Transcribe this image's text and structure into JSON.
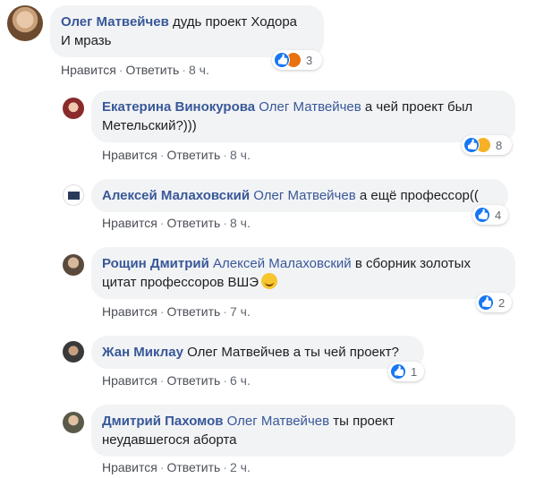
{
  "comments": [
    {
      "author": "Олег Матвейчев",
      "mention": "",
      "text_line1": "дудь проект Ходора",
      "text_line2": "И мразь",
      "like": "Нравится",
      "reply": "Ответить",
      "time": "8 ч.",
      "reaction_count": "3"
    },
    {
      "author": "Екатерина Винокурова",
      "mention": "Олег Матвейчев",
      "text_line1": "а чей проект был",
      "text_line2": "Метельский?)))",
      "like": "Нравится",
      "reply": "Ответить",
      "time": "8 ч.",
      "reaction_count": "8"
    },
    {
      "author": "Алексей Малаховский",
      "mention": "Олег Матвейчев",
      "text_line1": "а ещё профессор((",
      "like": "Нравится",
      "reply": "Ответить",
      "time": "8 ч.",
      "reaction_count": "4"
    },
    {
      "author": "Рощин Дмитрий",
      "mention": "Алексей Малаховский",
      "text_line1": "в сборник золотых",
      "text_line2": "цитат профессоров ВШЭ",
      "like": "Нравится",
      "reply": "Ответить",
      "time": "7 ч.",
      "reaction_count": "2"
    },
    {
      "author": "Жан Миклау",
      "mention": "Олег Матвейчев",
      "text_line1": "а ты чей проект?",
      "like": "Нравится",
      "reply": "Ответить",
      "time": "6 ч.",
      "reaction_count": "1"
    },
    {
      "author": "Дмитрий Пахомов",
      "mention": "Олег Матвейчев",
      "text_line1": "ты проект",
      "text_line2": "неудавшегося аборта",
      "like": "Нравится",
      "reply": "Ответить",
      "time": "2 ч."
    }
  ],
  "colors": {
    "link_blue": "#385898",
    "bubble_bg": "#f2f3f5",
    "like_blue": "#1877f2"
  },
  "icons": [
    "like-reaction-icon",
    "angry-reaction-icon",
    "haha-reaction-icon",
    "smile-emoji-icon"
  ]
}
